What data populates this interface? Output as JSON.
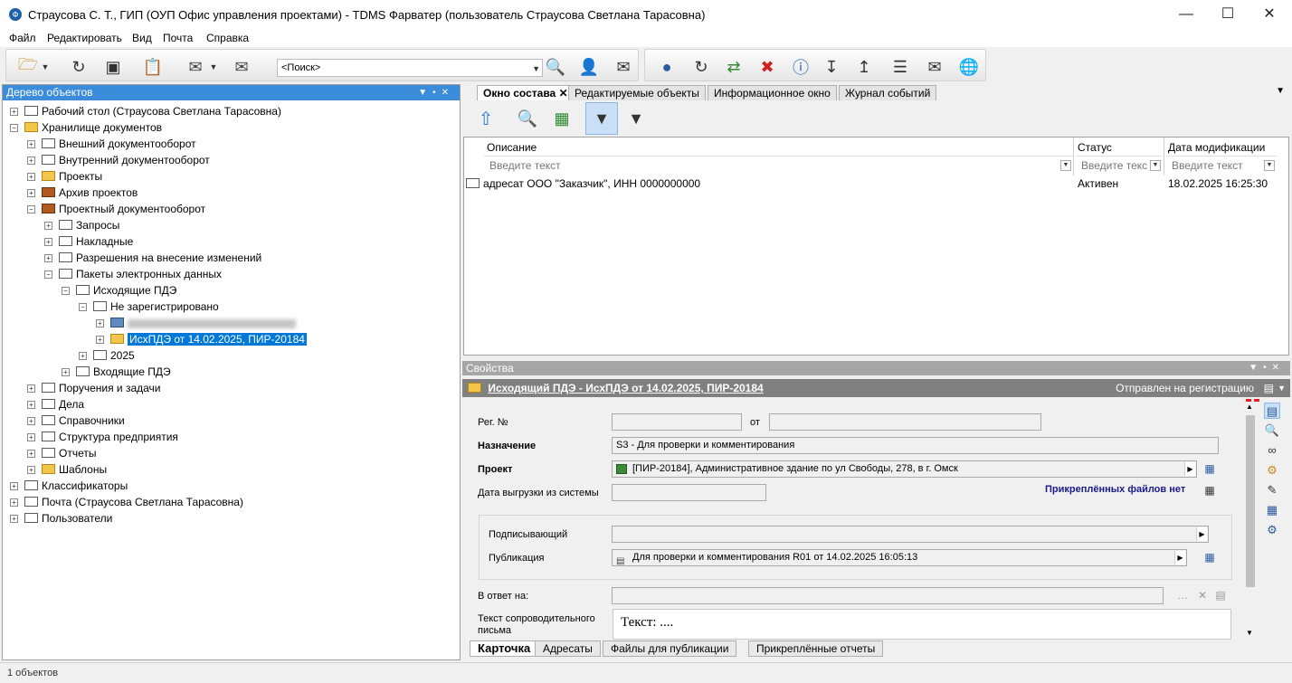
{
  "window": {
    "title": "Страусова С. Т., ГИП (ОУП Офис управления проектами) - TDMS Фарватер (пользователь Страусова Светлана Тарасовна)",
    "app_icon": "Ф"
  },
  "menu": [
    "Файл",
    "Редактировать",
    "Вид",
    "Почта",
    "Справка"
  ],
  "toolbar": {
    "search_placeholder": "<Поиск>"
  },
  "tree": {
    "header": "Дерево объектов",
    "items": [
      "Рабочий стол (Страусова Светлана Тарасовна)",
      "Хранилище документов",
      "Внешний документооборот",
      "Внутренний документооборот",
      "Проекты",
      "Архив проектов",
      "Проектный документооборот",
      "Запросы",
      "Накладные",
      "Разрешения на внесение изменений",
      "Пакеты электронных данных",
      "Исходящие ПДЭ",
      "Не зарегистрировано",
      "",
      "ИсхПДЭ от 14.02.2025, ПИР-20184",
      "2025",
      "Входящие ПДЭ",
      "Поручения и задачи",
      "Дела",
      "Справочники",
      "Структура предприятия",
      "Отчеты",
      "Шаблоны",
      "Классификаторы",
      "Почта (Страусова Светлана Тарасовна)",
      "Пользователи"
    ]
  },
  "tabs": [
    "Окно состава",
    "Редактируемые объекты",
    "Информационное окно",
    "Журнал событий"
  ],
  "grid": {
    "columns": [
      "Описание",
      "Статус",
      "Дата модификации"
    ],
    "filter_placeholder": "Введите текст",
    "filter_placeholder_short": "Введите текс",
    "rows": [
      {
        "desc": "адресат ООО \"Заказчик\", ИНН 0000000000",
        "status": "Активен",
        "date": "18.02.2025 16:25:30"
      }
    ]
  },
  "props": {
    "header": "Свойства",
    "title": "Исходящий ПДЭ - ИсхПДЭ от 14.02.2025, ПИР-20184",
    "state": "Отправлен на регистрацию",
    "reg_label": "Рег. №",
    "from_label": "от",
    "purpose_label": "Назначение",
    "purpose_value": "S3 - Для проверки и комментирования",
    "project_label": "Проект",
    "project_value": "[ПИР-20184], Административное здание по ул Свободы, 278, в г. Омск",
    "export_label": "Дата выгрузки из системы",
    "files_link": "Прикреплённых файлов нет",
    "signer_label": "Подписывающий",
    "pub_label": "Публикация",
    "pub_value": "Для проверки и комментирования R01 от 14.02.2025 16:05:13",
    "reply_label": "В ответ на:",
    "cover_label_1": "Текст сопроводительного",
    "cover_label_2": "письма",
    "cover_text": "Текст: ...."
  },
  "bottom_tabs": [
    "Карточка",
    "Адресаты",
    "Файлы для публикации",
    "Прикреплённые отчеты"
  ],
  "status_text": "1 объектов",
  "colors": {
    "accent": "#0078d7",
    "panel_header": "#3b8ddb",
    "link": "#1a1a8c",
    "red_dash": "#e02020"
  }
}
